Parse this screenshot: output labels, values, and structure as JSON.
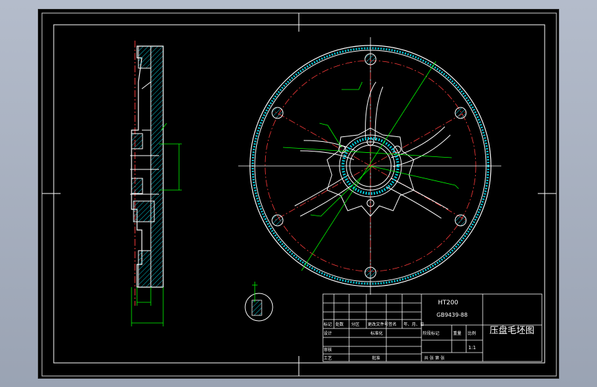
{
  "colors": {
    "background": "#000000",
    "outline": "#ffffff",
    "center_line": "#ff3b3b",
    "dimension": "#00ff00",
    "hatch": "#00c8d8",
    "window_gray": "#a9b1bf"
  },
  "drawing": {
    "title": "压盘毛坯图",
    "material": "HT200",
    "standard": "GB9439-88",
    "scale": "1:1"
  },
  "title_block": {
    "marks_row": [
      "标记",
      "处数",
      "分区",
      "更改文件号",
      "签名",
      "年、月、日"
    ],
    "designer_label": "设计",
    "standardization_label": "标准化",
    "review_label": "审核",
    "process_label": "工艺",
    "approve_label": "批准",
    "stage_label": "阶段标记",
    "weight_label": "重量",
    "ratio_label": "比例",
    "sheets_label": "共  张  第  张"
  },
  "icons": {
    "section_symbol": "section-view-icon",
    "crosshair": "crosshair-icon"
  }
}
